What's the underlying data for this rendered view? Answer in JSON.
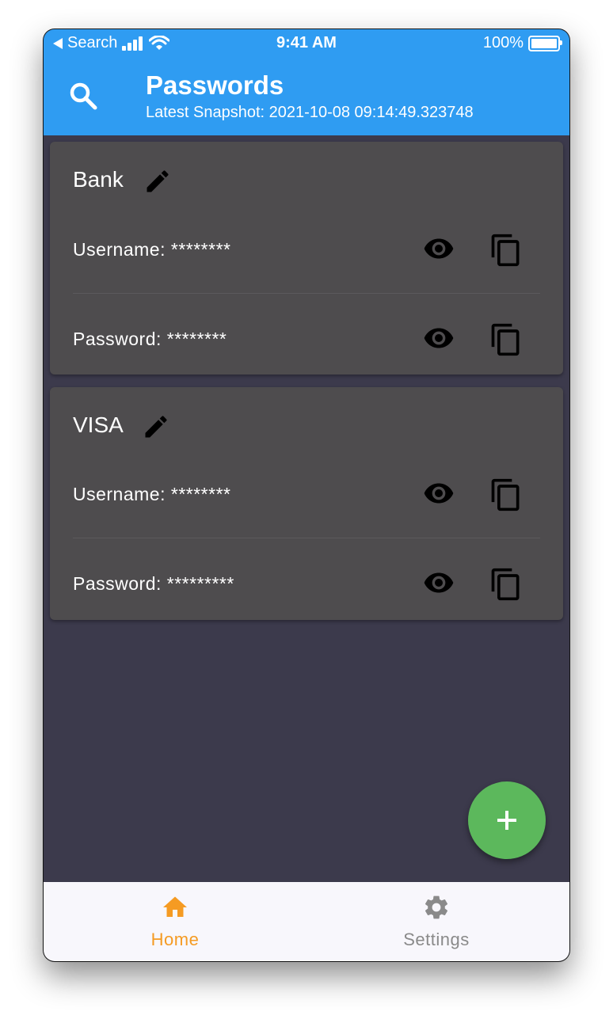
{
  "status_bar": {
    "back_label": "Search",
    "time": "9:41 AM",
    "battery": "100%"
  },
  "app_bar": {
    "title": "Passwords",
    "subtitle": "Latest Snapshot: 2021-10-08 09:14:49.323748"
  },
  "entries": [
    {
      "name": "Bank",
      "username_label": "Username: ********",
      "password_label": "Password: ********"
    },
    {
      "name": "VISA",
      "username_label": "Username: ********",
      "password_label": "Password: *********"
    }
  ],
  "bottom_nav": {
    "items": [
      {
        "label": "Home",
        "icon": "home-icon",
        "active": true
      },
      {
        "label": "Settings",
        "icon": "gear-icon",
        "active": false
      }
    ]
  },
  "colors": {
    "primary": "#2f9cf2",
    "background": "#3c3a4c",
    "card": "#4e4c4e",
    "fab": "#5cb85c",
    "active_nav": "#f59b23",
    "inactive_nav": "#8a8a8a"
  }
}
